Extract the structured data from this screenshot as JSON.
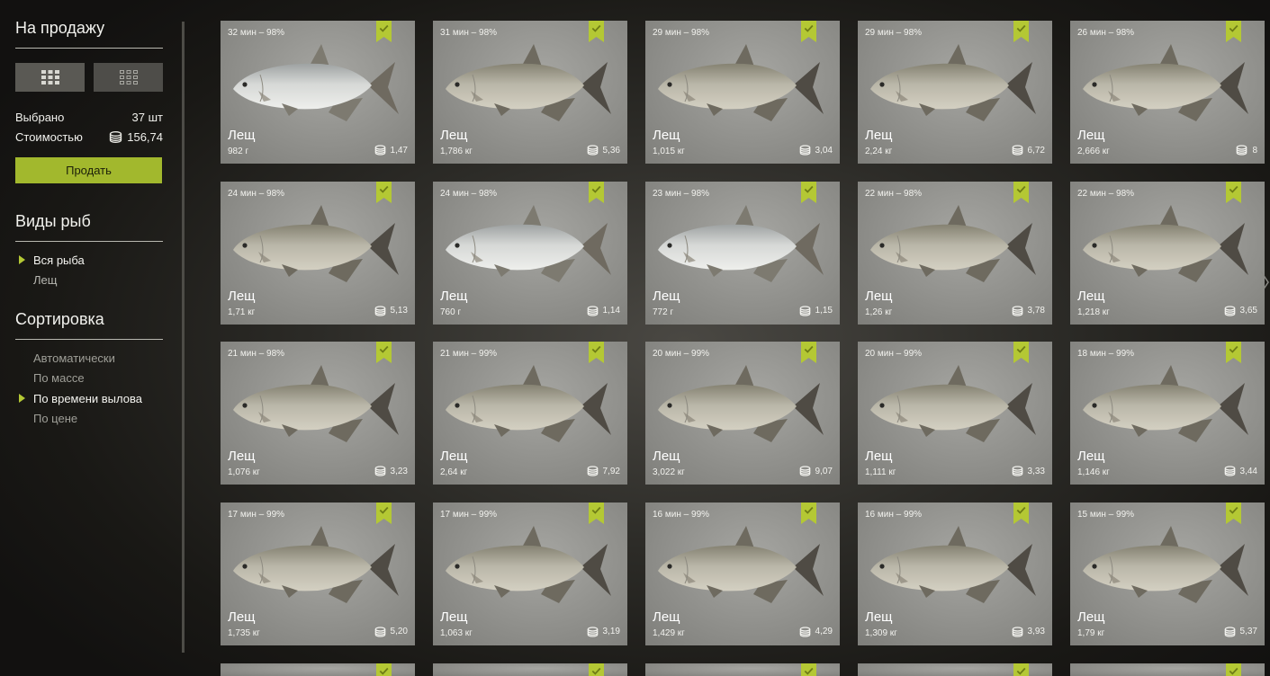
{
  "sidebar": {
    "sale_title": "На продажу",
    "view_buttons": [
      {
        "name": "grid-large-view"
      },
      {
        "name": "grid-small-view"
      }
    ],
    "selected_label": "Выбрано",
    "selected_value": "37 шт",
    "cost_label": "Стоимостью",
    "cost_value": "156,74",
    "sell_button": "Продать",
    "species_title": "Виды рыб",
    "species": [
      {
        "label": "Вся рыба",
        "active": true
      },
      {
        "label": "Лещ",
        "active": false
      }
    ],
    "sort_title": "Сортировка",
    "sort_options": [
      {
        "label": "Автоматически",
        "active": false
      },
      {
        "label": "По массе",
        "active": false
      },
      {
        "label": "По времени вылова",
        "active": true
      },
      {
        "label": "По цене",
        "active": false
      }
    ]
  },
  "colors": {
    "accent": "#a2b82d",
    "badge": "#b4c834",
    "card_bg": "#959591"
  },
  "icons": {
    "selected_badge": "bookmark-check-icon",
    "coin": "coin-stack-icon",
    "next": "chevron-right-icon"
  },
  "fish": [
    {
      "time": "32 мин – 98%",
      "name": "Лещ",
      "weight": "982 г",
      "price": "1,47",
      "silver": true
    },
    {
      "time": "31 мин – 98%",
      "name": "Лещ",
      "weight": "1,786 кг",
      "price": "5,36"
    },
    {
      "time": "29 мин – 98%",
      "name": "Лещ",
      "weight": "1,015 кг",
      "price": "3,04"
    },
    {
      "time": "29 мин – 98%",
      "name": "Лещ",
      "weight": "2,24 кг",
      "price": "6,72"
    },
    {
      "time": "26 мин – 98%",
      "name": "Лещ",
      "weight": "2,666 кг",
      "price": "8"
    },
    {
      "time": "24 мин – 98%",
      "name": "Лещ",
      "weight": "1,71 кг",
      "price": "5,13"
    },
    {
      "time": "24 мин – 98%",
      "name": "Лещ",
      "weight": "760 г",
      "price": "1,14",
      "silver": true
    },
    {
      "time": "23 мин – 98%",
      "name": "Лещ",
      "weight": "772 г",
      "price": "1,15",
      "silver": true
    },
    {
      "time": "22 мин – 98%",
      "name": "Лещ",
      "weight": "1,26 кг",
      "price": "3,78"
    },
    {
      "time": "22 мин – 98%",
      "name": "Лещ",
      "weight": "1,218 кг",
      "price": "3,65"
    },
    {
      "time": "21 мин – 98%",
      "name": "Лещ",
      "weight": "1,076 кг",
      "price": "3,23"
    },
    {
      "time": "21 мин – 99%",
      "name": "Лещ",
      "weight": "2,64 кг",
      "price": "7,92"
    },
    {
      "time": "20 мин – 99%",
      "name": "Лещ",
      "weight": "3,022 кг",
      "price": "9,07"
    },
    {
      "time": "20 мин – 99%",
      "name": "Лещ",
      "weight": "1,111 кг",
      "price": "3,33"
    },
    {
      "time": "18 мин – 99%",
      "name": "Лещ",
      "weight": "1,146 кг",
      "price": "3,44"
    },
    {
      "time": "17 мин – 99%",
      "name": "Лещ",
      "weight": "1,735 кг",
      "price": "5,20"
    },
    {
      "time": "17 мин – 99%",
      "name": "Лещ",
      "weight": "1,063 кг",
      "price": "3,19"
    },
    {
      "time": "16 мин – 99%",
      "name": "Лещ",
      "weight": "1,429 кг",
      "price": "4,29"
    },
    {
      "time": "16 мин – 99%",
      "name": "Лещ",
      "weight": "1,309 кг",
      "price": "3,93"
    },
    {
      "time": "15 мин – 99%",
      "name": "Лещ",
      "weight": "1,79 кг",
      "price": "5,37"
    }
  ],
  "partial_cards": 5
}
